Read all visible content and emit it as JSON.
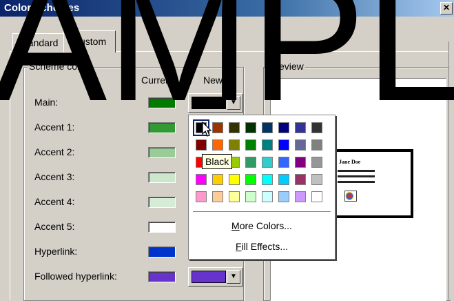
{
  "window": {
    "title": "Color Schemes",
    "close_glyph": "✕"
  },
  "tabs": [
    {
      "label": "Standard"
    },
    {
      "label": "Custom"
    }
  ],
  "scheme": {
    "group_label": "Scheme colors",
    "col_current": "Current",
    "col_new": "New",
    "rows": [
      {
        "label": "Main:",
        "current": "#007a00",
        "new": "#000000"
      },
      {
        "label": "Accent 1:",
        "current": "#339933",
        "new": null
      },
      {
        "label": "Accent 2:",
        "current": "#99cc99",
        "new": null
      },
      {
        "label": "Accent 3:",
        "current": "#cce6cc",
        "new": null
      },
      {
        "label": "Accent 4:",
        "current": "#d6ecd6",
        "new": null
      },
      {
        "label": "Accent 5:",
        "current": "#ffffff",
        "new": null
      },
      {
        "label": "Hyperlink:",
        "current": "#0033cc",
        "new": null
      },
      {
        "label": "Followed hyperlink:",
        "current": "#6633cc",
        "new": "#6633cc"
      }
    ],
    "dropdown_arrow": "▼"
  },
  "preview": {
    "label": "Preview",
    "card_name": "Jane Doe"
  },
  "palette": {
    "rows": [
      [
        "#000000",
        "#993300",
        "#333300",
        "#003300",
        "#003366",
        "#000080",
        "#333399",
        "#333333"
      ],
      [
        "#800000",
        "#ff6600",
        "#808000",
        "#008000",
        "#008080",
        "#0000ff",
        "#666699",
        "#808080"
      ],
      [
        "#ff0000",
        "#ff9900",
        "#99cc00",
        "#339966",
        "#33cccc",
        "#3366ff",
        "#800080",
        "#969696"
      ],
      [
        "#ff00ff",
        "#ffcc00",
        "#ffff00",
        "#00ff00",
        "#00ffff",
        "#00ccff",
        "#993366",
        "#c0c0c0"
      ],
      [
        "#ff99cc",
        "#ffcc99",
        "#ffff99",
        "#ccffcc",
        "#ccffff",
        "#99ccff",
        "#cc99ff",
        "#ffffff"
      ]
    ],
    "selected": "#000000",
    "tooltip": "Black",
    "more_colors": "More Colors...",
    "fill_effects": "Fill Effects..."
  },
  "watermark": {
    "text": "SAMPLE",
    "color": "#000000"
  }
}
